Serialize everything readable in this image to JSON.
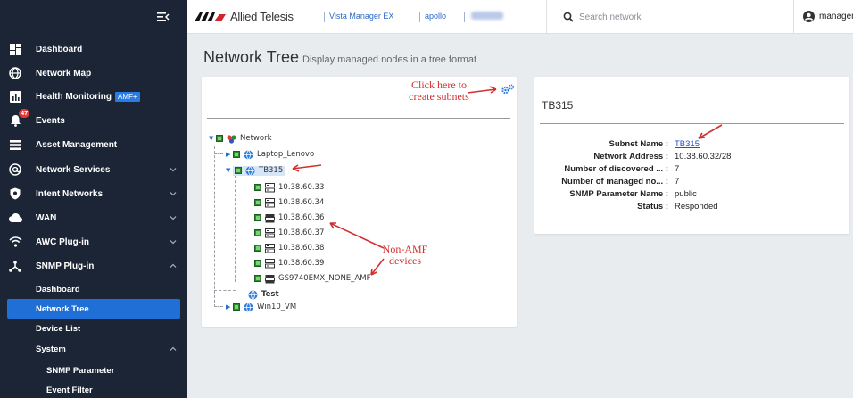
{
  "header": {
    "brand": "Allied Telesis",
    "product": "Vista Manager EX",
    "server": "apollo",
    "search_placeholder": "Search network",
    "user": "manager"
  },
  "sidebar": {
    "items": [
      {
        "label": "Dashboard",
        "icon": "dashboard-icon"
      },
      {
        "label": "Network Map",
        "icon": "globe-icon"
      },
      {
        "label": "Health Monitoring",
        "badge": "AMF+",
        "icon": "chart-icon"
      },
      {
        "label": "Events",
        "notification_count": "47",
        "icon": "bell-icon"
      },
      {
        "label": "Asset Management",
        "icon": "list-icon"
      },
      {
        "label": "Network Services",
        "icon": "at-icon",
        "expandable": true
      },
      {
        "label": "Intent Networks",
        "icon": "shield-icon",
        "expandable": true
      },
      {
        "label": "WAN",
        "icon": "cloud-icon",
        "expandable": true
      },
      {
        "label": "AWC Plug-in",
        "icon": "wifi-icon",
        "expandable": true
      },
      {
        "label": "SNMP Plug-in",
        "icon": "network-icon",
        "expanded": true
      }
    ],
    "snmp_sub": [
      {
        "label": "Dashboard"
      },
      {
        "label": "Network Tree",
        "active": true
      },
      {
        "label": "Device List"
      },
      {
        "label": "System",
        "expanded": true
      }
    ],
    "system_sub": [
      {
        "label": "SNMP Parameter"
      },
      {
        "label": "Event Filter"
      }
    ]
  },
  "page": {
    "title": "Network Tree",
    "subtitle": "Display managed nodes in a tree format"
  },
  "annotations": {
    "subnets_line1": "Click here to",
    "subnets_line2": "create subnets",
    "nonamf_line1": "Non-AMF",
    "nonamf_line2": "devices"
  },
  "tree": {
    "root": "Network",
    "laptop": "Laptop_Lenovo",
    "tb315": "TB315",
    "devices": [
      "10.38.60.33",
      "10.38.60.34",
      "10.38.60.36",
      "10.38.60.37",
      "10.38.60.38",
      "10.38.60.39",
      "GS9740EMX_NONE_AMF"
    ],
    "test": "Test",
    "win10": "Win10_VM"
  },
  "details": {
    "title": "TB315",
    "rows": [
      {
        "key": "Subnet Name :",
        "value": "TB315"
      },
      {
        "key": "Network Address :",
        "value": "10.38.60.32/28"
      },
      {
        "key": "Number of discovered ... :",
        "value": "7"
      },
      {
        "key": "Number of managed no... :",
        "value": "7"
      },
      {
        "key": "SNMP Parameter Name :",
        "value": "public"
      },
      {
        "key": "Status :",
        "value": "Responded"
      }
    ]
  },
  "colors": {
    "sidebar_bg": "#1c2535",
    "active": "#1f6fd6",
    "annotation": "#d32f2f",
    "link": "#1a4fd6"
  }
}
